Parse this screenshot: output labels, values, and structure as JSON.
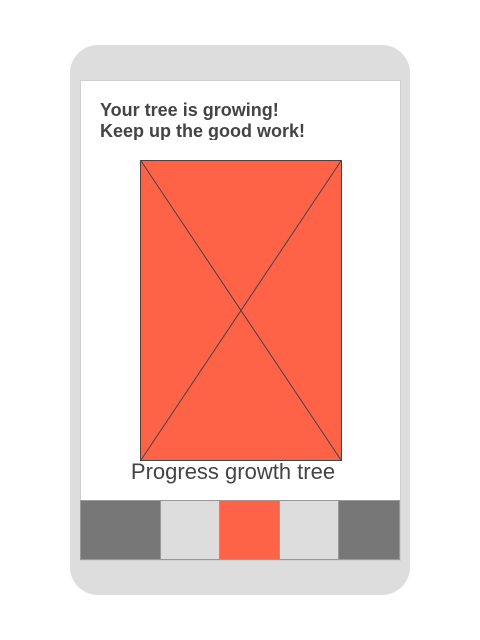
{
  "header": {
    "line1": "Your tree is growing!",
    "line2": "Keep up the good work!"
  },
  "tree": {
    "caption": "Progress growth tree",
    "icon": "image-placeholder-icon"
  },
  "colors": {
    "accent": "#ff6347",
    "frame": "#dddddd",
    "tab_dark": "#777777",
    "tab_light": "#dddddd",
    "text": "#444444"
  },
  "tabbar": {
    "tabs": [
      {
        "name": "tab-1",
        "color": "#777777"
      },
      {
        "name": "tab-2",
        "color": "#dddddd"
      },
      {
        "name": "tab-3",
        "color": "#ff6347"
      },
      {
        "name": "tab-4",
        "color": "#dddddd"
      },
      {
        "name": "tab-5",
        "color": "#777777"
      }
    ]
  }
}
